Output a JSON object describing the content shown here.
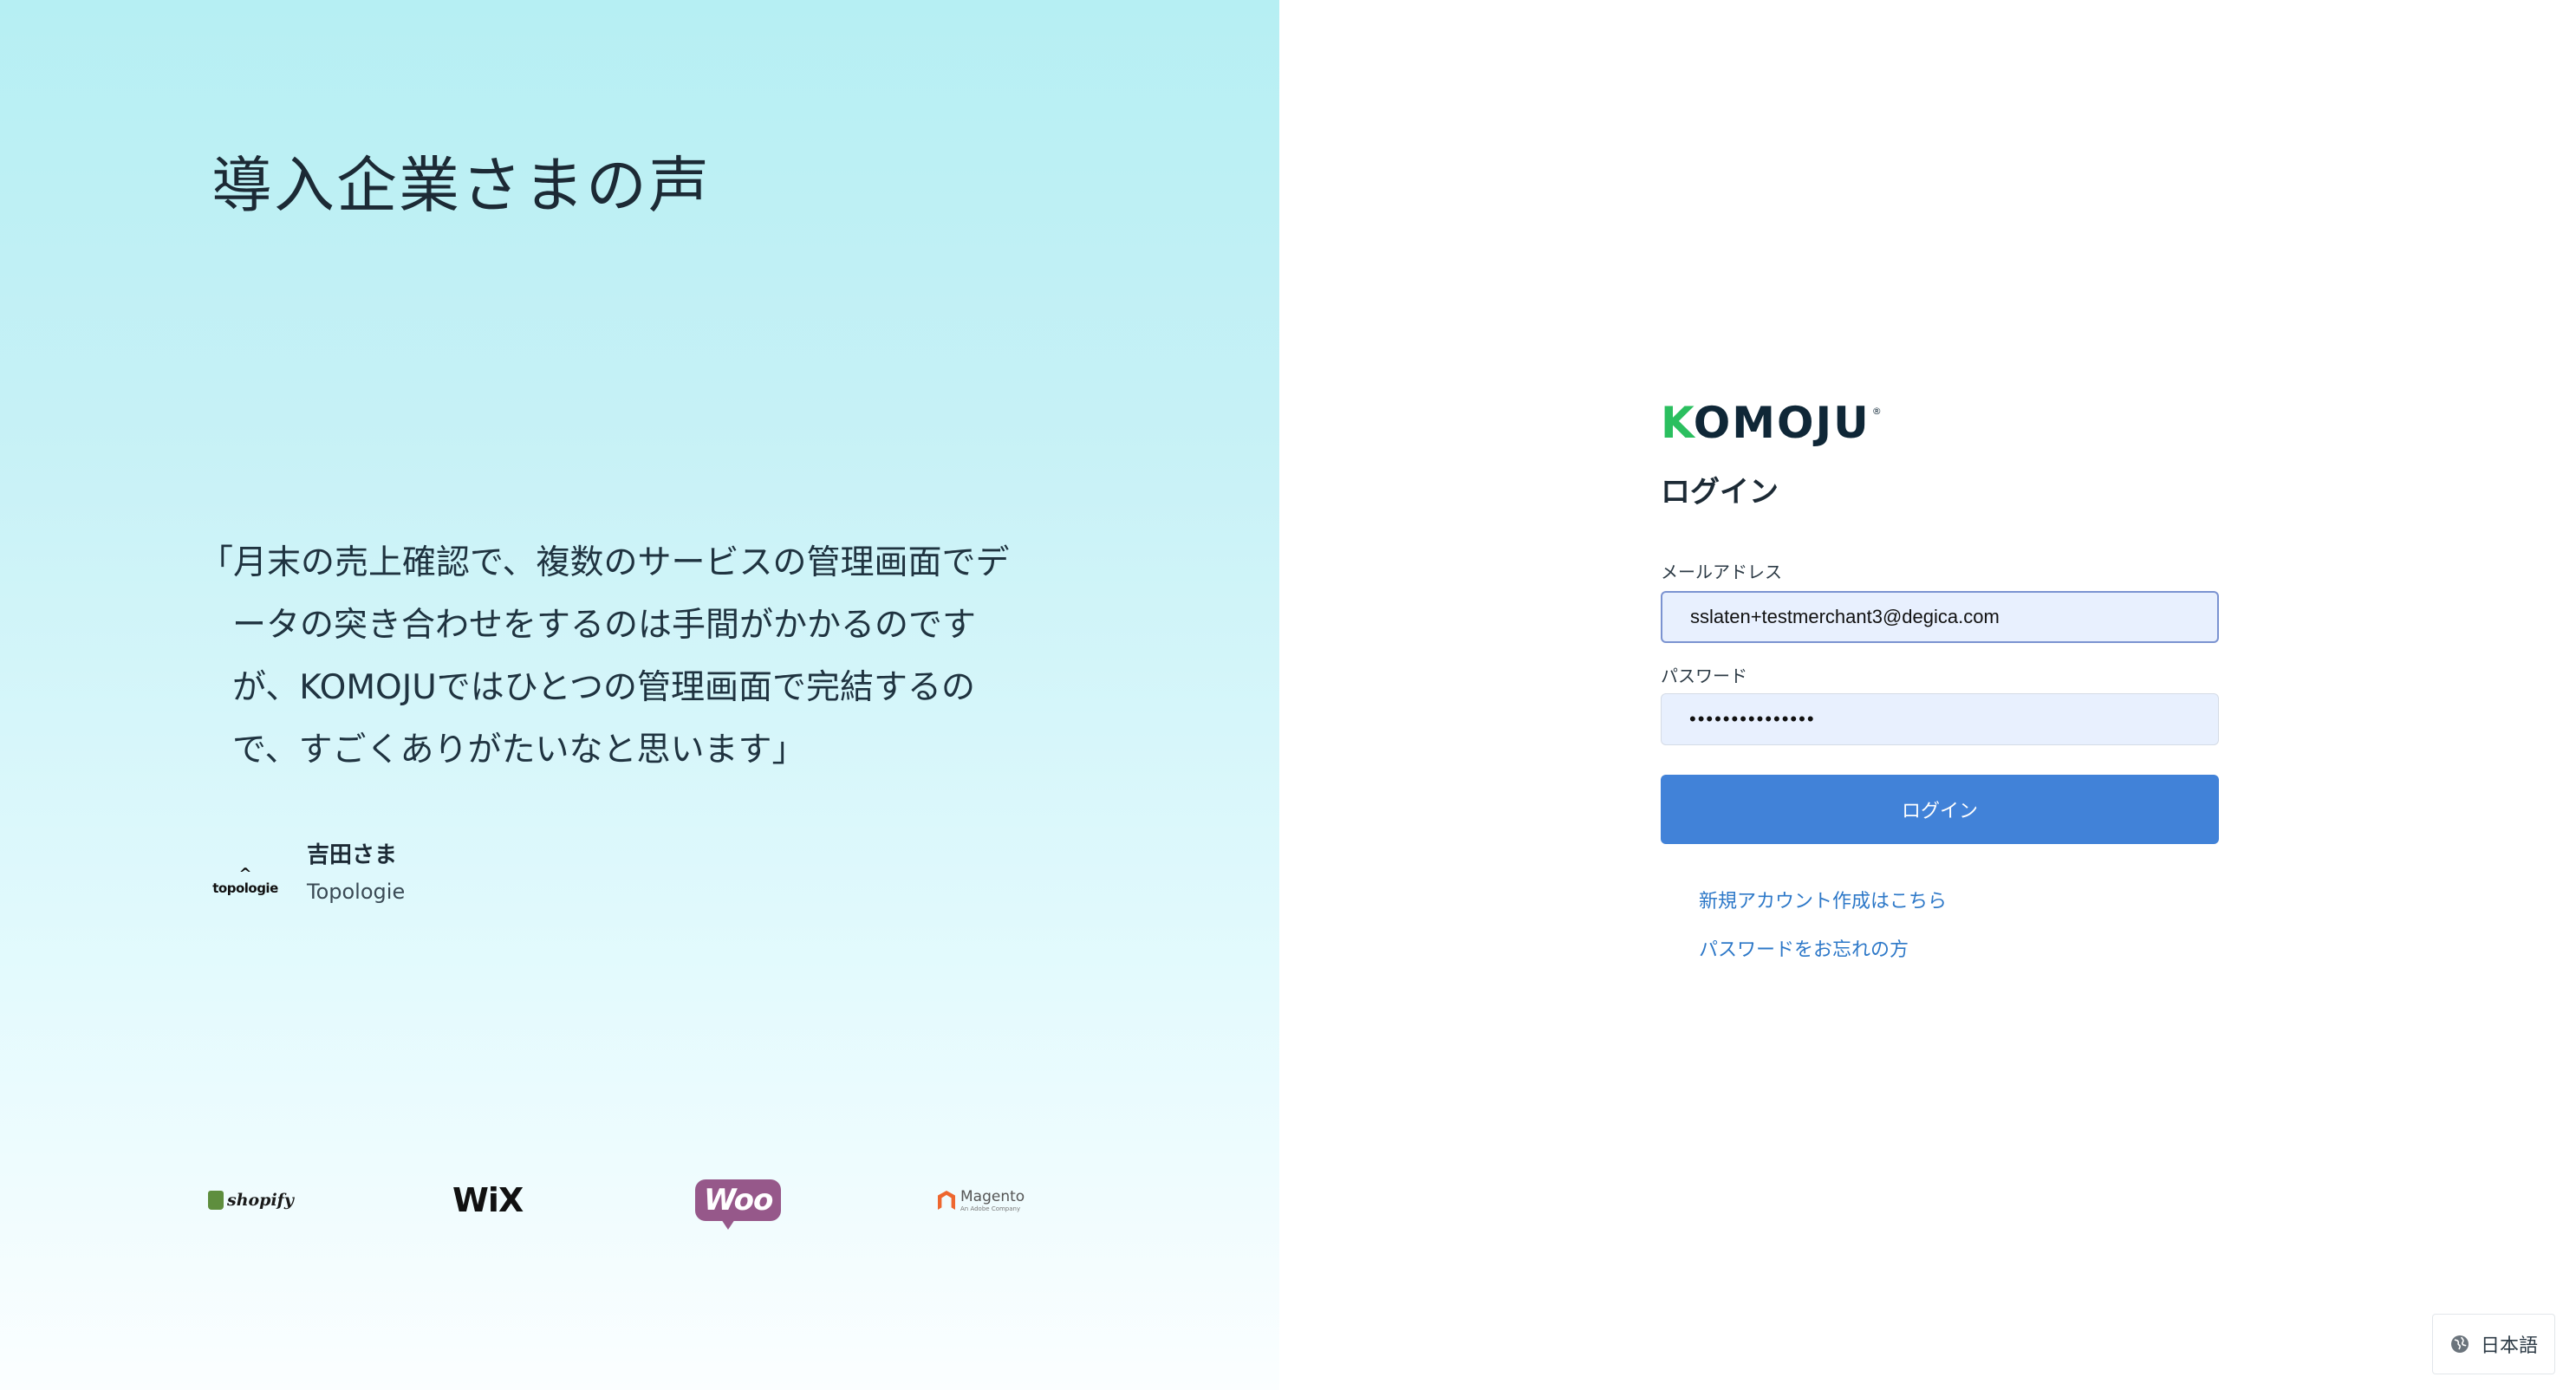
{
  "testimonial": {
    "heading": "導入企業さまの声",
    "quote_lines": [
      "「月末の売上確認で、複数のサービスの管理画面でデ",
      "ータの突き合わせをするのは手間がかかるのです",
      "が、KOMOJUではひとつの管理画面で完結するの",
      "で、すごくありがたいなと思います」"
    ],
    "author_name": "吉田さま",
    "author_company": "Topologie",
    "author_logo_text": "topologie"
  },
  "partners": {
    "shopify": "shopify",
    "wix": "WiX",
    "woo": "Woo",
    "magento": "Magento",
    "magento_sub": "An Adobe Company"
  },
  "login": {
    "brand_k": "K",
    "brand_rest": "OMOJU",
    "brand_reg": "®",
    "title": "ログイン",
    "email_label": "メールアドレス",
    "email_value": "sslaten+testmerchant3@degica.com",
    "password_label": "パスワード",
    "password_value": "•••••••••••••••",
    "submit_label": "ログイン",
    "signup_link": "新規アカウント作成はこちら",
    "forgot_link": "パスワードをお忘れの方"
  },
  "language": {
    "current": "日本語",
    "icon": "globe-icon"
  },
  "colors": {
    "brand_green": "#2bbf5f",
    "brand_navy": "#0f2737",
    "button_blue": "#4182d8",
    "link_blue": "#2d78c8",
    "input_bg": "#e8f0fe"
  }
}
